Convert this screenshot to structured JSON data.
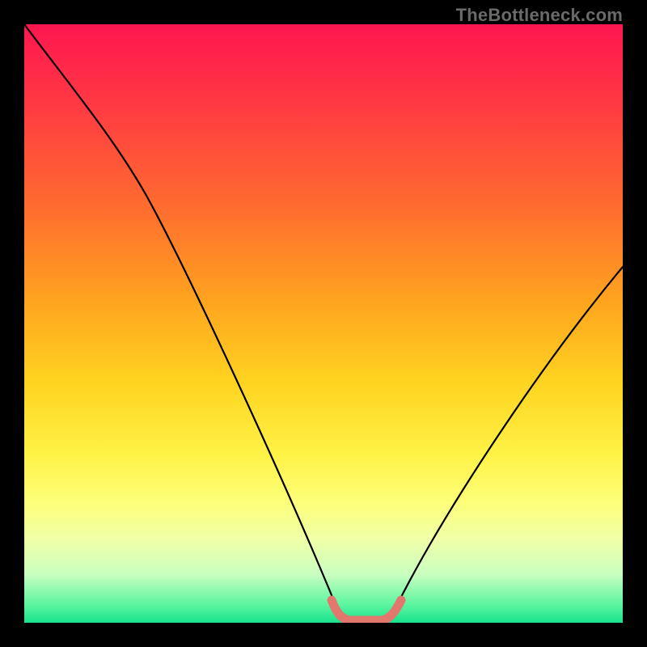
{
  "watermark": "TheBottleneck.com",
  "chart_data": {
    "type": "line",
    "title": "",
    "xlabel": "",
    "ylabel": "",
    "xlim": [
      0,
      100
    ],
    "ylim": [
      0,
      100
    ],
    "x": [
      0,
      5,
      10,
      15,
      20,
      25,
      30,
      35,
      40,
      45,
      50,
      52,
      55,
      58,
      60,
      65,
      70,
      75,
      80,
      85,
      90,
      95,
      100
    ],
    "values": [
      100,
      93,
      86,
      79,
      71,
      62,
      52,
      42,
      31,
      19,
      7,
      2,
      0,
      0,
      1,
      6,
      13,
      21,
      29,
      37,
      45,
      53,
      60
    ],
    "annotations": [
      {
        "type": "flat-bottom-marker",
        "x_range": [
          52,
          60
        ],
        "y": 0
      }
    ]
  }
}
